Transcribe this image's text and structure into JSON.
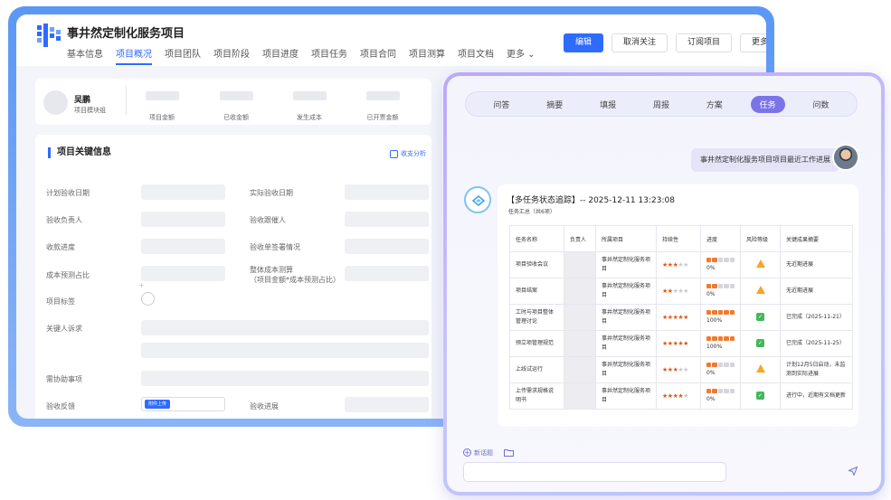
{
  "project": {
    "title": "事井然定制化服务项目",
    "nav": [
      "基本信息",
      "项目概况",
      "项目团队",
      "项目阶段",
      "项目进度",
      "项目任务",
      "项目合同",
      "项目测算",
      "项目文档",
      "更多"
    ],
    "buttons": {
      "edit": "编辑",
      "unfollow": "取消关注",
      "subscribe": "订阅项目",
      "more": "更多"
    }
  },
  "user_card": {
    "name": "吴鹏",
    "role": "项目模块组",
    "stats": [
      "项目金额",
      "已收金额",
      "发生成本",
      "已开票金额"
    ]
  },
  "info": {
    "title": "项目关键信息",
    "link": "收支分析",
    "labels": {
      "plan_date": "计划验收日期",
      "actual_date": "实际验收日期",
      "accept_owner": "验收负责人",
      "accept_follow": "验收跟催人",
      "collect_progress": "收款进度",
      "sign_status": "验收单签署情况",
      "cost_ratio": "成本预测占比",
      "overall_cost_1": "整体成本测算",
      "overall_cost_2": "（项目金额*成本预测占比）",
      "tags": "项目标签",
      "key_appeal": "关键人诉求",
      "help_items": "需协助事项",
      "feedback": "验收反馈",
      "upload": "附件上传",
      "accept_progress": "验收进展"
    }
  },
  "chat": {
    "tabs": [
      "问答",
      "摘要",
      "填报",
      "周报",
      "方案",
      "任务",
      "问数"
    ],
    "active_tab": "任务",
    "user_message": "事井然定制化服务项目项目最近工作进展",
    "answer_title": "【多任务状态追踪】-- 2025-12-11 13:23:08",
    "answer_subtitle": "任务汇总（共6项）",
    "table_headers": [
      "任务名称",
      "负责人",
      "所属项目",
      "持续性",
      "进度",
      "风险等级",
      "关键成果摘要"
    ],
    "tasks": [
      {
        "name": "项目验收会议",
        "owner": "",
        "project": "事井然定制化服务项目",
        "stars": 3,
        "progress": "0%",
        "bar": 2,
        "risk": "warn",
        "summary": "无近期进展"
      },
      {
        "name": "项目结案",
        "owner": "",
        "project": "事井然定制化服务项目",
        "stars": 2,
        "progress": "0%",
        "bar": 2,
        "risk": "warn",
        "summary": "无近期进展"
      },
      {
        "name": "工时与项目整体管理讨论",
        "owner": "",
        "project": "事井然定制化服务项目",
        "stars": 5,
        "progress": "100%",
        "bar": 5,
        "risk": "ok",
        "summary": "已完成（2025-11-21）"
      },
      {
        "name": "预立项管理规范",
        "owner": "",
        "project": "事井然定制化服务项目",
        "stars": 5,
        "progress": "100%",
        "bar": 5,
        "risk": "ok",
        "summary": "已完成（2025-11-25）"
      },
      {
        "name": "上线试运行",
        "owner": "",
        "project": "事井然定制化服务项目",
        "stars": 3,
        "progress": "0%",
        "bar": 2,
        "risk": "warn",
        "summary": "计划12月5日启动，未监测到实际进展"
      },
      {
        "name": "上传需求规格说明书",
        "owner": "",
        "project": "事井然定制化服务项目",
        "stars": 4,
        "progress": "0%",
        "bar": 2,
        "risk": "ok",
        "summary": "进行中，近期有文档更新"
      }
    ],
    "new_chat": "新话题"
  },
  "colors": {
    "primary": "#2f6bff",
    "chat_accent": "#7b74e8",
    "star": "#e05a1c",
    "warn": "#f5a623",
    "ok": "#43b85a"
  }
}
